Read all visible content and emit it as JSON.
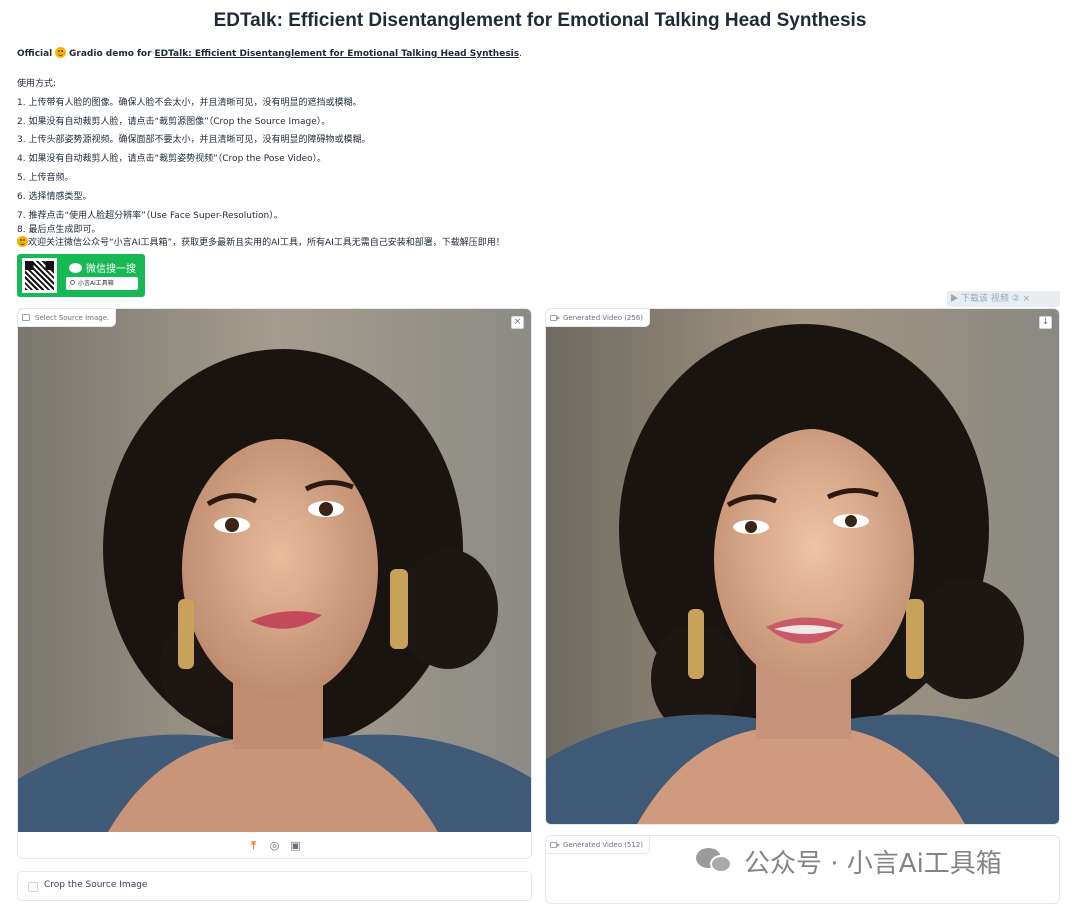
{
  "title": "EDTalk: Efficient Disentanglement for Emotional Talking Head Synthesis",
  "intro": {
    "official": "Official",
    "gradio_demo_for": "Gradio demo for",
    "link_text": "EDTalk: Efficient Disentanglement for Emotional Talking Head Synthesis",
    "period": "."
  },
  "usage": {
    "heading": "使用方式:",
    "steps": [
      "1. 上传带有人脸的图像。确保人脸不会太小，并且清晰可见，没有明显的遮挡或模糊。",
      "2. 如果没有自动裁剪人脸，请点击“裁剪源图像”（Crop the Source Image）。",
      "3. 上传头部姿势源视频。确保面部不要太小，并且清晰可见，没有明显的障碍物或模糊。",
      "4. 如果没有自动裁剪人脸，请点击“裁剪姿势视频”（Crop the Pose Video）。",
      "5. 上传音频。",
      "6. 选择情感类型。",
      "7. 推荐点击“使用人脸超分辨率”（Use Face Super-Resolution）。",
      "8. 最后点生成即可。"
    ],
    "promo": "欢迎关注微信公众号“小言AI工具箱”，获取更多最新且实用的AI工具，所有AI工具无需自己安装和部署，下载解压即用！"
  },
  "wechat": {
    "label": "微信搜一搜",
    "search_text": "小言Ai工具箱"
  },
  "download_overlay": "下载该 视频 ② ×",
  "source_panel": {
    "label": "Select Source Image.",
    "close": "×",
    "toolbar_icons": [
      "upload-icon",
      "webcam-icon",
      "clipboard-icon"
    ]
  },
  "crop": {
    "label": "Crop the Source Image",
    "checked": false
  },
  "gen256": {
    "label": "Generated Video (256)",
    "download": "↓"
  },
  "gen512": {
    "label": "Generated Video (512)"
  },
  "watermark": "公众号 · 小言Ai工具箱",
  "colors": {
    "wechat_green": "#17b955",
    "accent_orange": "#f97316"
  }
}
